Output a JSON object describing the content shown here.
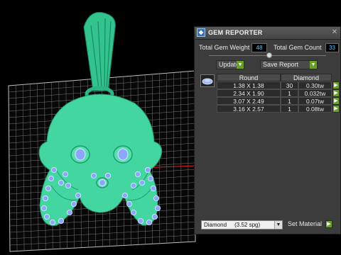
{
  "panel": {
    "title": "GEM REPORTER",
    "icon": "gem-app-icon",
    "close_icon": "close-icon"
  },
  "stats": {
    "total_weight_label": "Total Gem Weight",
    "total_weight_value": "48",
    "total_count_label": "Total Gem Count",
    "total_count_value": "33"
  },
  "actions": {
    "update_label": "Update",
    "save_report_label": "Save Report"
  },
  "table": {
    "headers": [
      "Round",
      "Diamond"
    ],
    "rows": [
      {
        "size": "1.38 X 1.38",
        "count": "30",
        "weight": "0.30tw"
      },
      {
        "size": "2.34 X 1.90",
        "count": "1",
        "weight": "0.032tw"
      },
      {
        "size": "3.07 X 2.49",
        "count": "1",
        "weight": "0.07tw"
      },
      {
        "size": "3.16 X 2.57",
        "count": "1",
        "weight": "0.08tw"
      }
    ]
  },
  "material": {
    "selected": "Diamond     (3.52 spg)",
    "set_label": "Set Material"
  },
  "colors": {
    "model": "#44d6a0",
    "model_dark": "#1f9a70",
    "gem": "#8aa6ff",
    "accent_green": "#6aa02a",
    "value_blue": "#4fc7ff"
  }
}
